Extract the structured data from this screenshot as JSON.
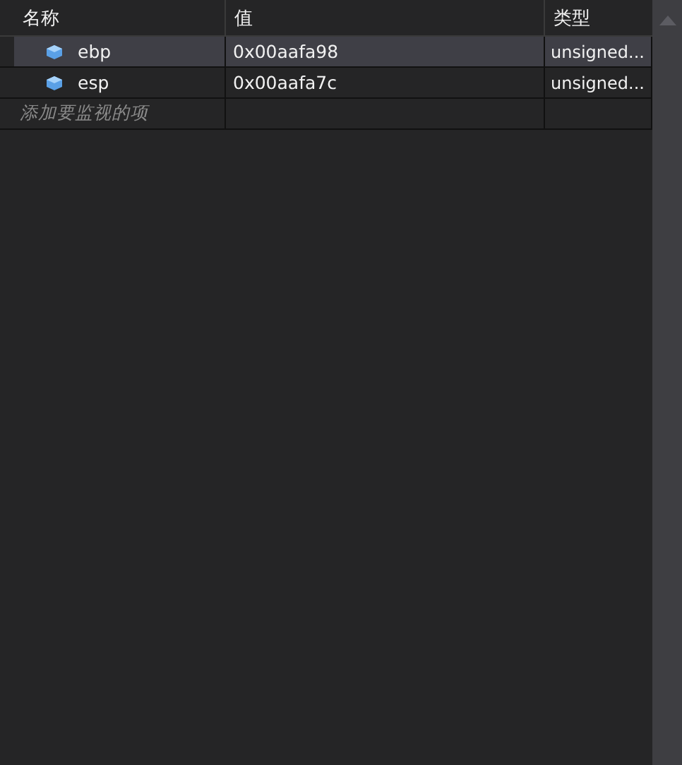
{
  "columns": [
    "名称",
    "值",
    "类型"
  ],
  "rows": [
    {
      "name": "ebp",
      "value": "0x00aafa98",
      "type": "unsigned...",
      "selected": true
    },
    {
      "name": "esp",
      "value": "0x00aafa7c",
      "type": "unsigned...",
      "selected": false
    }
  ],
  "add_placeholder": "添加要监视的项"
}
